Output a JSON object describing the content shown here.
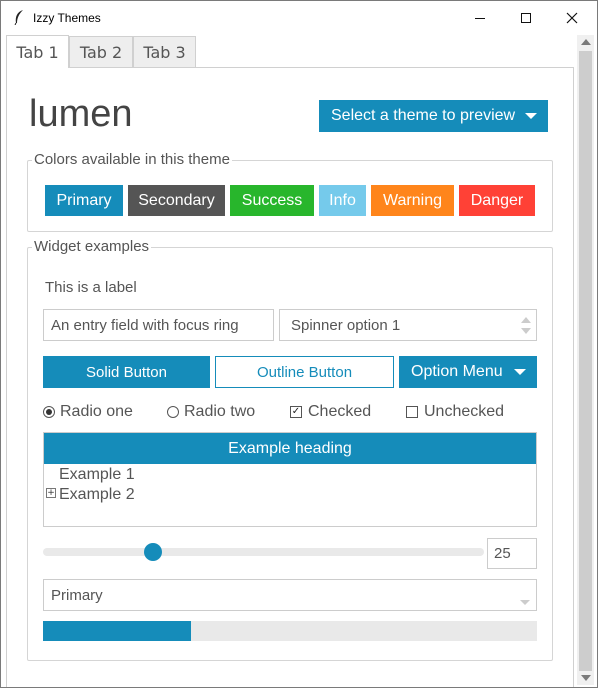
{
  "window": {
    "title": "Izzy Themes",
    "icon": "feather-icon"
  },
  "tabs": [
    {
      "label": "Tab 1",
      "active": true
    },
    {
      "label": "Tab 2",
      "active": false
    },
    {
      "label": "Tab 3",
      "active": false
    }
  ],
  "header": {
    "theme_name": "lumen",
    "theme_select_label": "Select a theme to preview"
  },
  "colors_group": {
    "title": "Colors available in this theme",
    "swatches": [
      {
        "label": "Primary",
        "color": "#158cba"
      },
      {
        "label": "Secondary",
        "color": "#555555"
      },
      {
        "label": "Success",
        "color": "#28b62c"
      },
      {
        "label": "Info",
        "color": "#75caeb"
      },
      {
        "label": "Warning",
        "color": "#ff851b"
      },
      {
        "label": "Danger",
        "color": "#ff4136"
      }
    ]
  },
  "widgets_group": {
    "title": "Widget examples",
    "label_text": "This is a label",
    "entry_value": "An entry field with focus ring",
    "spinner_value": "Spinner option 1",
    "solid_button": "Solid Button",
    "outline_button": "Outline Button",
    "option_menu": "Option Menu",
    "radio_one": {
      "label": "Radio one",
      "selected": true
    },
    "radio_two": {
      "label": "Radio two",
      "selected": false
    },
    "checked": {
      "label": "Checked",
      "checked": true
    },
    "unchecked": {
      "label": "Unchecked",
      "checked": false
    },
    "tree": {
      "heading": "Example heading",
      "items": [
        "Example 1",
        "Example 2"
      ]
    },
    "scale_value": "25",
    "scale_fraction": 0.25,
    "combobox_value": "Primary",
    "progress_fraction": 0.3
  },
  "accent_color": "#158cba"
}
